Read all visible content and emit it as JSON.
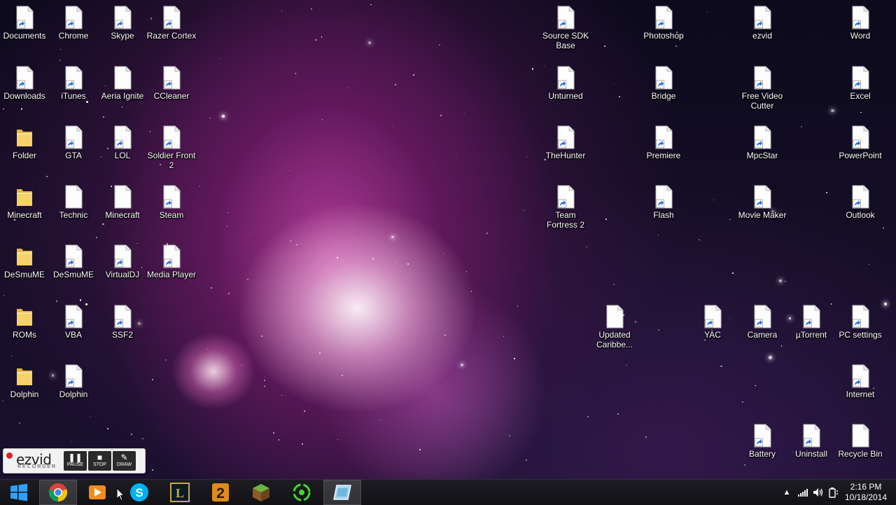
{
  "desktop": {
    "icons": [
      {
        "label": "Documents",
        "type": "shortcut"
      },
      {
        "label": "Chrome",
        "type": "shortcut"
      },
      {
        "label": "Skype",
        "type": "shortcut"
      },
      {
        "label": "Razer Cortex",
        "type": "shortcut"
      },
      {
        "label": "Downloads",
        "type": "shortcut"
      },
      {
        "label": "iTunes",
        "type": "shortcut"
      },
      {
        "label": "Aeria Ignite",
        "type": "file"
      },
      {
        "label": "CCleaner",
        "type": "shortcut"
      },
      {
        "label": "Folder",
        "type": "folder"
      },
      {
        "label": "GTA",
        "type": "shortcut"
      },
      {
        "label": "LOL",
        "type": "shortcut"
      },
      {
        "label": "Soldier Front 2",
        "type": "shortcut"
      },
      {
        "label": "Minecraft",
        "type": "folder"
      },
      {
        "label": "Technic",
        "type": "file"
      },
      {
        "label": "Minecraft",
        "type": "file"
      },
      {
        "label": "Steam",
        "type": "shortcut"
      },
      {
        "label": "DeSmuME",
        "type": "folder"
      },
      {
        "label": "DeSmuME",
        "type": "shortcut"
      },
      {
        "label": "VirtualDJ",
        "type": "shortcut"
      },
      {
        "label": "Media Player",
        "type": "shortcut"
      },
      {
        "label": "ROMs",
        "type": "folder"
      },
      {
        "label": "VBA",
        "type": "shortcut"
      },
      {
        "label": "SSF2",
        "type": "shortcut"
      },
      {
        "label": "Dolphin",
        "type": "folder"
      },
      {
        "label": "Dolphin",
        "type": "shortcut"
      },
      {
        "label": "Source SDK Base",
        "type": "shortcut"
      },
      {
        "label": "Photoshop",
        "type": "shortcut"
      },
      {
        "label": "ezvid",
        "type": "shortcut"
      },
      {
        "label": "Word",
        "type": "shortcut"
      },
      {
        "label": "Unturned",
        "type": "shortcut"
      },
      {
        "label": "Bridge",
        "type": "shortcut"
      },
      {
        "label": "Free Video Cutter",
        "type": "shortcut"
      },
      {
        "label": "Excel",
        "type": "shortcut"
      },
      {
        "label": "TheHunter",
        "type": "shortcut"
      },
      {
        "label": "Premiere",
        "type": "shortcut"
      },
      {
        "label": "MpcStar",
        "type": "shortcut"
      },
      {
        "label": "PowerPoint",
        "type": "shortcut"
      },
      {
        "label": "Team Fortress 2",
        "type": "shortcut"
      },
      {
        "label": "Flash",
        "type": "shortcut"
      },
      {
        "label": "Movie Maker",
        "type": "shortcut"
      },
      {
        "label": "Outlook",
        "type": "shortcut"
      },
      {
        "label": "Updated Caribbe...",
        "type": "file"
      },
      {
        "label": "YAC",
        "type": "shortcut"
      },
      {
        "label": "Camera",
        "type": "shortcut"
      },
      {
        "label": "µTorrent",
        "type": "shortcut"
      },
      {
        "label": "PC settings",
        "type": "shortcut"
      },
      {
        "label": "Internet",
        "type": "shortcut"
      },
      {
        "label": "Battery",
        "type": "shortcut"
      },
      {
        "label": "Uninstall",
        "type": "shortcut"
      },
      {
        "label": "Recycle Bin",
        "type": "file"
      }
    ]
  },
  "ezvid": {
    "logo": "ezvid",
    "subtitle": "RECORDER",
    "pause_label": "PAUSE",
    "stop_label": "STOP",
    "draw_label": "DRAW"
  },
  "taskbar": {
    "apps": [
      {
        "name": "start",
        "icon": "windows-logo-icon"
      },
      {
        "name": "chrome",
        "icon": "chrome-icon",
        "active": true
      },
      {
        "name": "media-player",
        "icon": "media-player-icon"
      },
      {
        "name": "skype",
        "icon": "skype-icon"
      },
      {
        "name": "league-of-legends",
        "icon": "lol-icon"
      },
      {
        "name": "soldier-front-2",
        "icon": "sf2-icon"
      },
      {
        "name": "minecraft",
        "icon": "minecraft-icon"
      },
      {
        "name": "razer-cortex",
        "icon": "cortex-icon"
      },
      {
        "name": "app",
        "icon": "blue-window-icon",
        "active": true
      }
    ],
    "clock": {
      "time": "2:16 PM",
      "date": "10/18/2014"
    }
  },
  "colors": {
    "taskbar": "#111116",
    "folder": "#f2c94c",
    "shortcut_arrow": "#2a6fd6"
  }
}
